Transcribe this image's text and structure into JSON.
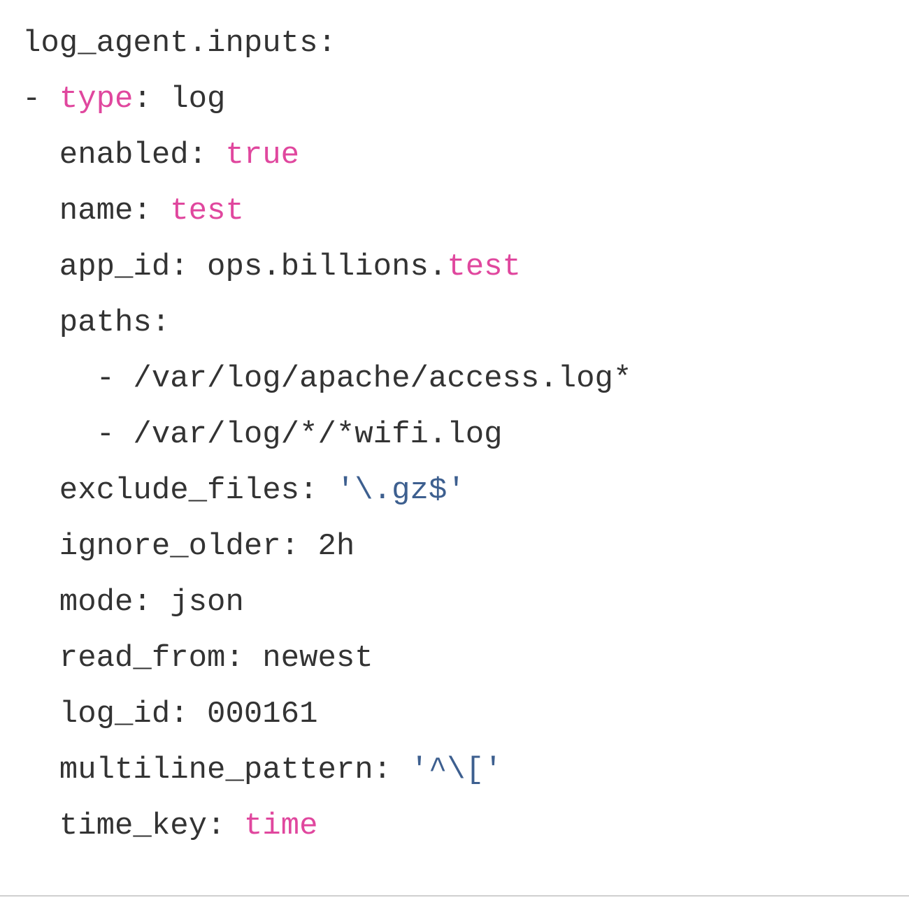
{
  "colors": {
    "text": "#333333",
    "keyword": "#e0479e",
    "string": "#3d5f8f",
    "divider": "#cfcfcf"
  },
  "code": {
    "language": "yaml",
    "lines": [
      {
        "tokens": [
          {
            "t": "log_agent.inputs:",
            "k": "plain"
          }
        ]
      },
      {
        "tokens": [
          {
            "t": "- ",
            "k": "plain"
          },
          {
            "t": "type",
            "k": "kw"
          },
          {
            "t": ": log",
            "k": "plain"
          }
        ]
      },
      {
        "tokens": [
          {
            "t": "  enabled: ",
            "k": "plain"
          },
          {
            "t": "true",
            "k": "kw"
          }
        ]
      },
      {
        "tokens": [
          {
            "t": "  name: ",
            "k": "plain"
          },
          {
            "t": "test",
            "k": "kw"
          }
        ]
      },
      {
        "tokens": [
          {
            "t": "  app_id: ops.billions.",
            "k": "plain"
          },
          {
            "t": "test",
            "k": "kw"
          }
        ]
      },
      {
        "tokens": [
          {
            "t": "  paths:",
            "k": "plain"
          }
        ]
      },
      {
        "tokens": [
          {
            "t": "    - /var/log/apache/access.log*",
            "k": "plain"
          }
        ]
      },
      {
        "tokens": [
          {
            "t": "    - /var/log/*/*wifi.log",
            "k": "plain"
          }
        ]
      },
      {
        "tokens": [
          {
            "t": "  exclude_files: ",
            "k": "plain"
          },
          {
            "t": "'\\.gz$'",
            "k": "str"
          }
        ]
      },
      {
        "tokens": [
          {
            "t": "  ignore_older: 2h",
            "k": "plain"
          }
        ]
      },
      {
        "tokens": [
          {
            "t": "  mode: json",
            "k": "plain"
          }
        ]
      },
      {
        "tokens": [
          {
            "t": "  read_from: newest",
            "k": "plain"
          }
        ]
      },
      {
        "tokens": [
          {
            "t": "  log_id: 000161",
            "k": "plain"
          }
        ]
      },
      {
        "tokens": [
          {
            "t": "  multiline_pattern: ",
            "k": "plain"
          },
          {
            "t": "'^\\['",
            "k": "str"
          }
        ]
      },
      {
        "tokens": [
          {
            "t": "  time_key: ",
            "k": "plain"
          },
          {
            "t": "time",
            "k": "kw"
          }
        ]
      }
    ]
  }
}
